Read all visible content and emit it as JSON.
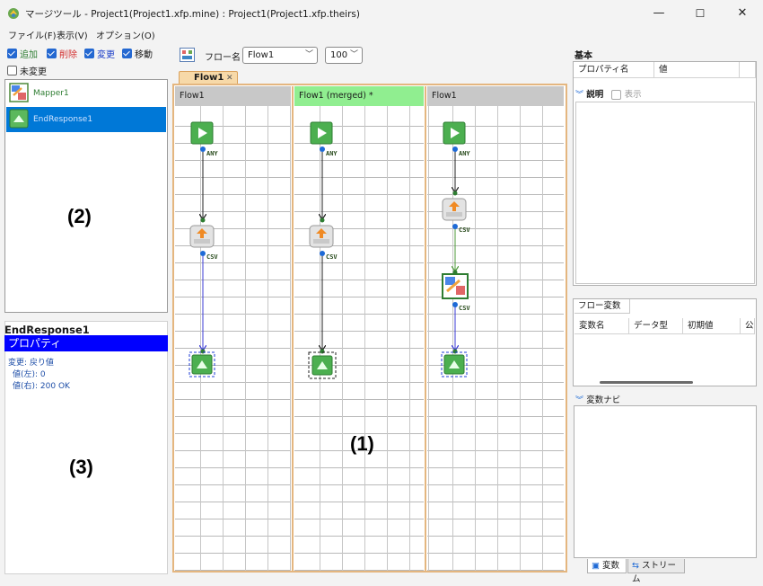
{
  "window": {
    "title": "マージツール - Project1(Project1.xfp.mine) : Project1(Project1.xfp.theirs)",
    "minimize": "—",
    "maximize": "☐",
    "close": "✕"
  },
  "menu": [
    "ファイル(F)",
    "表示(V)",
    "オプション(O)"
  ],
  "filters": {
    "add": "追加",
    "delete": "削除",
    "change": "変更",
    "move": "移動",
    "unchanged": "未変更"
  },
  "tree": {
    "items": [
      "Mapper1",
      "EndResponse1"
    ],
    "overlay_label": "(2)"
  },
  "properties": {
    "node_name": "EndResponse1",
    "header": "プロパティ",
    "lines": [
      "変更: 戻り値",
      "値(左): 0",
      "値(右): 200 OK"
    ],
    "overlay_label": "(3)"
  },
  "toolbar": {
    "flow_name_label": "フロー名",
    "flow_name_value": "Flow1",
    "zoom_value": "100"
  },
  "tab": {
    "label": "Flow1",
    "close": "✕"
  },
  "columns": [
    {
      "header": "Flow1",
      "header_color": "#c8c8c8"
    },
    {
      "header": "Flow1 (merged) *",
      "header_color": "#90ee90"
    },
    {
      "header": "Flow1",
      "header_color": "#c8c8c8"
    }
  ],
  "ports": {
    "any": "ANY",
    "csv": "CSV"
  },
  "center_overlay_label": "(1)",
  "right": {
    "basic_tab": "基本",
    "prop_col_name": "プロパティ名",
    "prop_col_value": "値",
    "description_label": "説明",
    "show_label": "表示",
    "flow_vars_tab": "フロー変数",
    "var_cols": [
      "変数名",
      "データ型",
      "初期値",
      "公"
    ],
    "var_nav_label": "変数ナビ",
    "bottom_tabs": [
      "変数",
      "ストリーム"
    ]
  },
  "colors": {
    "selection": "#0078d7",
    "prop_header": "#0000ff",
    "merged_header": "#90ee90",
    "frame_border": "#e4b67f",
    "checkbox": "#2468d1"
  }
}
